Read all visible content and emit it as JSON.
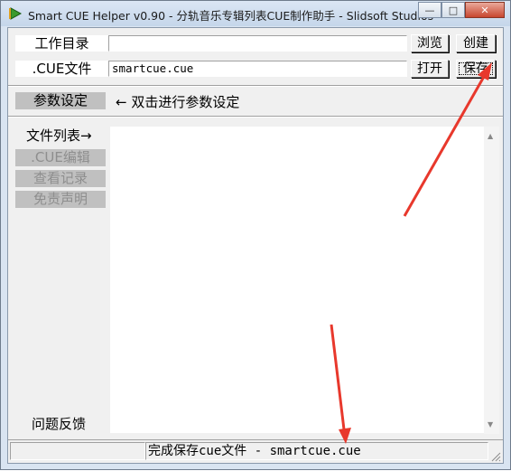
{
  "window": {
    "title": "Smart CUE Helper v0.90 - 分轨音乐专辑列表CUE制作助手 - Slidsoft Studios",
    "min_glyph": "—",
    "max_glyph": "□",
    "close_glyph": "✕"
  },
  "rows": {
    "workdir": {
      "label": "工作目录",
      "value": "",
      "browse": "浏览",
      "create": "创建"
    },
    "cuefile": {
      "label": ".CUE文件",
      "value": "smartcue.cue",
      "open": "打开",
      "save": "保存"
    }
  },
  "settings": {
    "button": "参数设定",
    "hint": "← 双击进行参数设定"
  },
  "sidebar": {
    "items": [
      {
        "label": "文件列表→"
      },
      {
        "label": ".CUE编辑"
      },
      {
        "label": "查看记录"
      },
      {
        "label": "免责声明"
      }
    ],
    "feedback": "问题反馈"
  },
  "status": {
    "message": "完成保存cue文件 - smartcue.cue"
  },
  "colors": {
    "annotation_arrow": "#e8382c",
    "panel_bg": "#f0f0f0",
    "grey_button": "#c0c0c0"
  }
}
